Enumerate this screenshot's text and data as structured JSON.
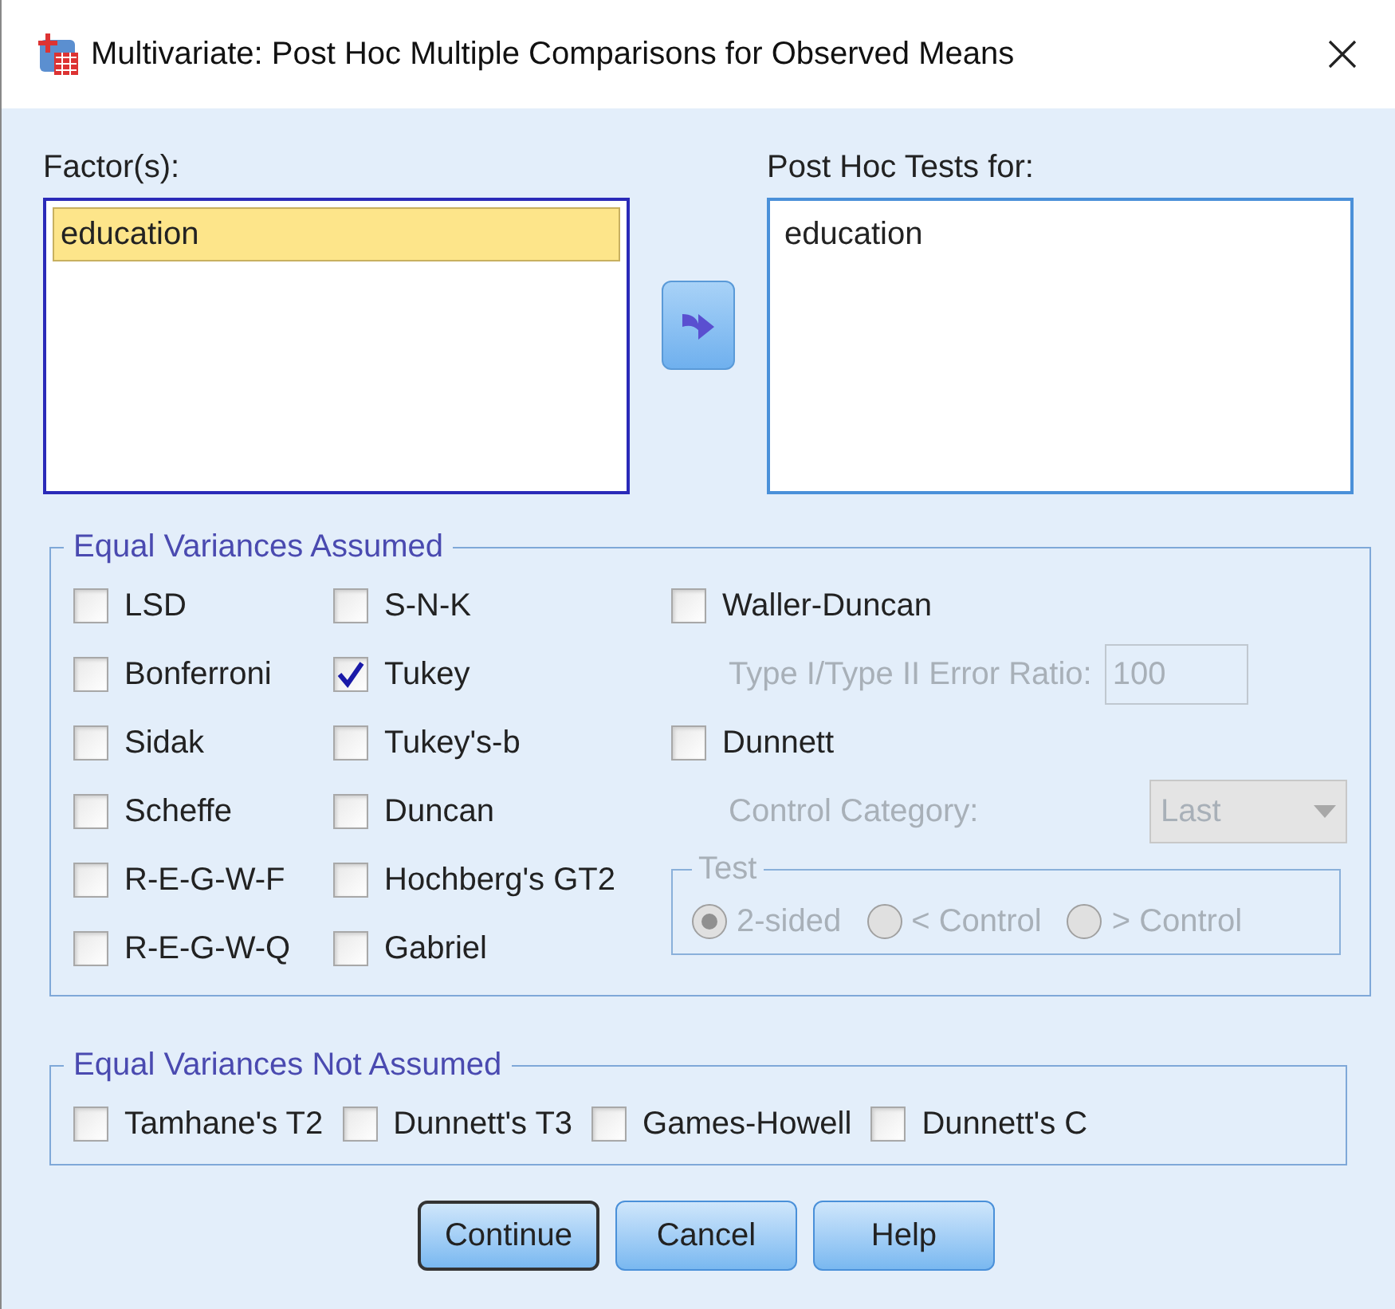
{
  "window": {
    "title": "Multivariate: Post Hoc Multiple Comparisons for Observed Means"
  },
  "factors": {
    "label": "Factor(s):",
    "items": [
      {
        "text": "education",
        "selected": true
      }
    ]
  },
  "post_hoc_for": {
    "label": "Post Hoc Tests for:",
    "items": [
      {
        "text": "education",
        "selected": false
      }
    ]
  },
  "equal_variances_assumed": {
    "title": "Equal Variances Assumed",
    "column_1": [
      {
        "label": "LSD",
        "checked": false
      },
      {
        "label": "Bonferroni",
        "checked": false
      },
      {
        "label": "Sidak",
        "checked": false
      },
      {
        "label": "Scheffe",
        "checked": false
      },
      {
        "label": "R-E-G-W-F",
        "checked": false
      },
      {
        "label": "R-E-G-W-Q",
        "checked": false
      }
    ],
    "column_2": [
      {
        "label": "S-N-K",
        "checked": false
      },
      {
        "label": "Tukey",
        "checked": true
      },
      {
        "label": "Tukey's-b",
        "checked": false
      },
      {
        "label": "Duncan",
        "checked": false
      },
      {
        "label": "Hochberg's GT2",
        "checked": false
      },
      {
        "label": "Gabriel",
        "checked": false
      }
    ],
    "waller_duncan": {
      "label": "Waller-Duncan",
      "checked": false
    },
    "error_ratio": {
      "label": "Type I/Type II Error Ratio:",
      "value": "100",
      "disabled": true
    },
    "dunnett": {
      "label": "Dunnett",
      "checked": false
    },
    "control_category": {
      "label": "Control Category:",
      "value": "Last",
      "disabled": true
    },
    "test": {
      "title": "Test",
      "disabled": true,
      "options": [
        {
          "label": "2-sided",
          "selected": true
        },
        {
          "label": "< Control",
          "selected": false
        },
        {
          "label": "> Control",
          "selected": false
        }
      ]
    }
  },
  "equal_variances_not_assumed": {
    "title": "Equal Variances Not Assumed",
    "tests": [
      {
        "label": "Tamhane's T2",
        "checked": false
      },
      {
        "label": "Dunnett's T3",
        "checked": false
      },
      {
        "label": "Games-Howell",
        "checked": false
      },
      {
        "label": "Dunnett's C",
        "checked": false
      }
    ]
  },
  "buttons": [
    {
      "label": "Continue",
      "default": true
    },
    {
      "label": "Cancel",
      "default": false
    },
    {
      "label": "Help",
      "default": false
    }
  ]
}
